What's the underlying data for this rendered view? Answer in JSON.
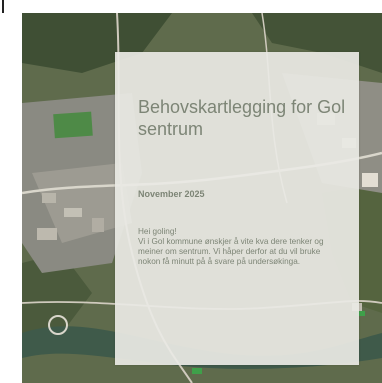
{
  "colors": {
    "card_background": "#e9e9e4",
    "text": "#7d8576"
  },
  "background": {
    "type": "aerial-photo",
    "icon": "aerial-map-image"
  },
  "card": {
    "title": "Behovskartlegging for Gol sentrum",
    "date": "November 2025",
    "intro": {
      "greeting": "Hei goling!",
      "body": "Vi i Gol kommune ønskjer å vite kva dere tenker og meiner om sentrum. Vi håper derfor at du vil bruke nokon få minutt på å svare på undersøkinga."
    }
  }
}
